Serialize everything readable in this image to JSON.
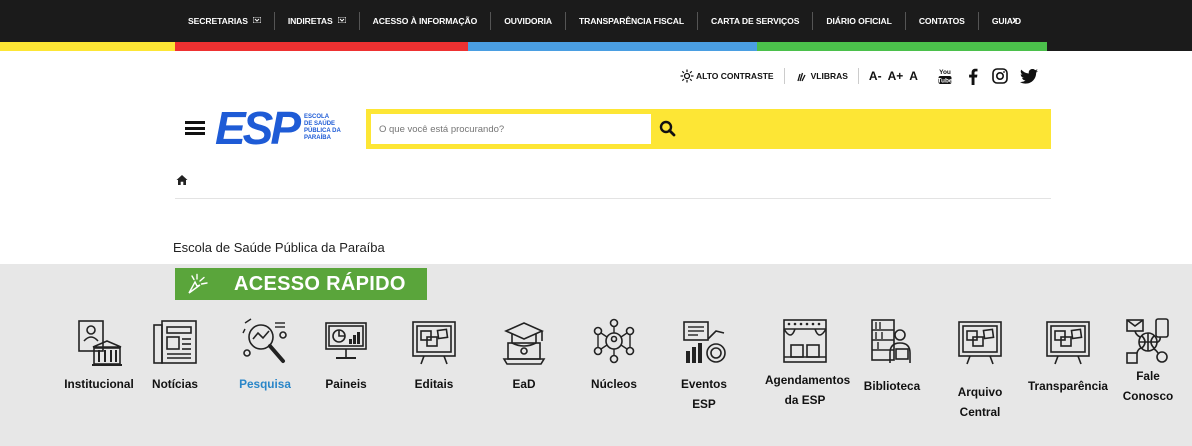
{
  "topnav": {
    "items": [
      {
        "label": "SECRETARIAS",
        "dropdown": true
      },
      {
        "label": "INDIRETAS",
        "dropdown": true
      },
      {
        "label": "ACESSO À INFORMAÇÃO",
        "dropdown": false
      },
      {
        "label": "OUVIDORIA",
        "dropdown": false
      },
      {
        "label": "TRANSPARÊNCIA FISCAL",
        "dropdown": false
      },
      {
        "label": "CARTA DE SERVIÇOS",
        "dropdown": false
      },
      {
        "label": "DIÁRIO OFICIAL",
        "dropdown": false
      },
      {
        "label": "CONTATOS",
        "dropdown": false
      },
      {
        "label": "GUIA D",
        "dropdown": false
      }
    ],
    "more_icon": "chevron-right-icon"
  },
  "colorbar": [
    "#fde635",
    "#ee3131",
    "#4a9ee2",
    "#4bc04b",
    "#1b1b1b"
  ],
  "accessibility": {
    "contrast_label": "ALTO CONTRASTE",
    "vlibras_label": "VLIBRAS",
    "font_decrease": "A-",
    "font_increase": "A+",
    "font_reset": "A",
    "youtube_text": "You Tube"
  },
  "logo": {
    "text": "ESP",
    "subtitle_line1": "ESCOLA",
    "subtitle_line2": "DE SAÚDE",
    "subtitle_line3": "PÚBLICA DA",
    "subtitle_line4": "PARAÍBA"
  },
  "search": {
    "placeholder": "O que você está procurando?",
    "color": "#fde635"
  },
  "site_title": "Escola de Saúde Pública da Paraíba",
  "quick_access": {
    "title": "ACESSO RÁPIDO",
    "banner_color": "#5aa53b",
    "items": [
      {
        "line1": "Institucional",
        "line2": "",
        "icon": "building-icon",
        "active": false
      },
      {
        "line1": "Notícias",
        "line2": "",
        "icon": "newspaper-icon",
        "active": false
      },
      {
        "line1": "Pesquisa",
        "line2": "",
        "icon": "research-icon",
        "active": true
      },
      {
        "line1": "Paineis",
        "line2": "",
        "icon": "dashboard-icon",
        "active": false
      },
      {
        "line1": "Editais",
        "line2": "",
        "icon": "board-icon",
        "active": false
      },
      {
        "line1": "EaD",
        "line2": "",
        "icon": "elearning-icon",
        "active": false
      },
      {
        "line1": "Núcleos",
        "line2": "",
        "icon": "network-icon",
        "active": false
      },
      {
        "line1": "Eventos",
        "line2": "ESP",
        "icon": "events-icon",
        "active": false
      },
      {
        "line1": "Agendamentos",
        "line2": "da ESP",
        "icon": "stage-icon",
        "active": false
      },
      {
        "line1": "Biblioteca",
        "line2": "",
        "icon": "library-icon",
        "active": false
      },
      {
        "line1": "Arquivo",
        "line2": "Central",
        "icon": "archive-icon",
        "active": false
      },
      {
        "line1": "Transparência",
        "line2": "",
        "icon": "transparency-icon",
        "active": false
      },
      {
        "line1": "Fale",
        "line2": "Conosco",
        "icon": "contact-icon",
        "active": false
      }
    ]
  }
}
